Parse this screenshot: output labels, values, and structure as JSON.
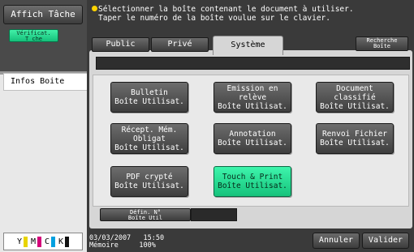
{
  "sidebar": {
    "affich_label": "Affich Tâche",
    "verif_label_1": "Vérificat.",
    "verif_label_2": "T che",
    "infos_tab": "Infos Boite",
    "toner": [
      {
        "letter": "Y",
        "color": "#e8d400"
      },
      {
        "letter": "M",
        "color": "#d4007a"
      },
      {
        "letter": "C",
        "color": "#00a0e0"
      },
      {
        "letter": "K",
        "color": "#111111"
      }
    ]
  },
  "message": {
    "line1": "Sélectionner la boîte contenant le document à utiliser.",
    "line2": "Taper le numéro de la boîte voulue sur le clavier."
  },
  "tabs": {
    "public": "Public",
    "prive": "Privé",
    "systeme": "Système",
    "recherche_1": "Recherche",
    "recherche_2": "Boîte"
  },
  "boxes": [
    {
      "line1": "Bulletin",
      "line2": "Boîte Utilisat.",
      "selected": false
    },
    {
      "line1": "Emission en relève",
      "line2": "Boîte Utilisat.",
      "selected": false
    },
    {
      "line1": "Document classifié",
      "line2": "Boîte Utilisat.",
      "selected": false
    },
    {
      "line1": "Récept. Mém. Obligat",
      "line2": "Boîte Utilisat.",
      "selected": false
    },
    {
      "line1": "Annotation",
      "line2": "Boîte Utilisat.",
      "selected": false
    },
    {
      "line1": "Renvoi Fichier",
      "line2": "Boîte Utilisat.",
      "selected": false
    },
    {
      "line1": "PDF crypté",
      "line2": "Boîte Utilisat.",
      "selected": false
    },
    {
      "line1": "Touch & Print",
      "line2": "Boîte Utilisat.",
      "selected": true
    }
  ],
  "defin": {
    "line1": "Défin. N°",
    "line2": "Boîte Util"
  },
  "status": {
    "date": "03/03/2007",
    "time": "15:50",
    "memory_label": "Mémoire",
    "memory_value": "100%"
  },
  "buttons": {
    "annuler": "Annuler",
    "valider": "Valider"
  },
  "colors": {
    "accent_green": "#22d68c",
    "toolbar_dark": "#3a3a3a"
  }
}
